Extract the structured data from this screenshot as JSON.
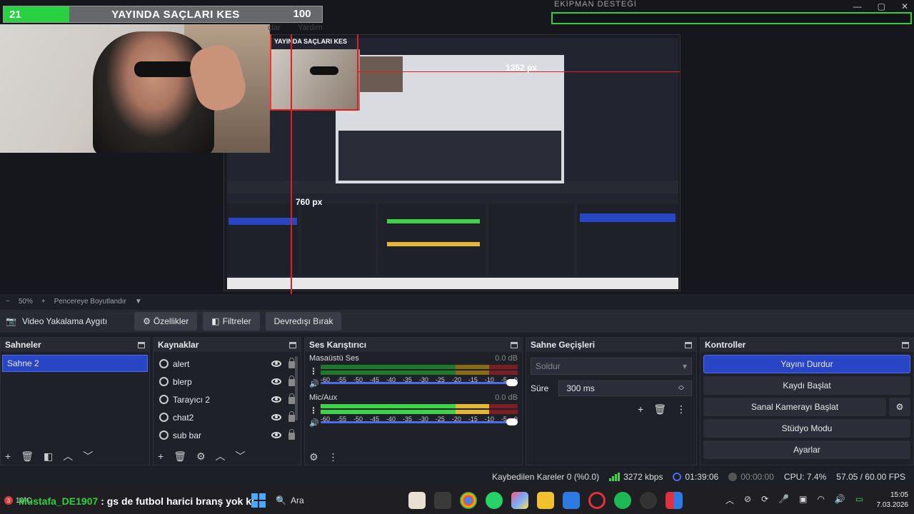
{
  "window": {
    "minimize": "—",
    "maximize": "▢",
    "close": "✕"
  },
  "overlay": {
    "count": "21",
    "title": "YAYINDA SAÇLARI KES",
    "hundred": "100",
    "left_sub": "çlar",
    "right_sub": "Yardım",
    "support_label": "EKİPMAN DESTEĞİ"
  },
  "nested": {
    "title": "YAYINDA SAÇLARI KES",
    "width_label": "1352 px",
    "height_label": "760 px"
  },
  "zoom": {
    "minus": "−",
    "value": "50%",
    "plus": "+",
    "fit": "Pencereye Boyutlandır"
  },
  "source_toolbar": {
    "source_name": "Video Yakalama Aygıtı",
    "properties": "Özellikler",
    "filters": "Filtreler",
    "deactivate": "Devredışı Bırak"
  },
  "scenes": {
    "title": "Sahneler",
    "items": [
      "Sahne 2"
    ]
  },
  "sources": {
    "title": "Kaynaklar",
    "items": [
      "alert",
      "blerp",
      "Tarayıcı 2",
      "chat2",
      "sub bar"
    ]
  },
  "mixer": {
    "title": "Ses Karıştırıcı",
    "channels": [
      {
        "name": "Masaüstü Ses",
        "db": "0.0 dB",
        "level": 0.1
      },
      {
        "name": "Mic/Aux",
        "db": "0.0 dB",
        "level": 0.9
      }
    ],
    "scale": [
      "-60",
      "-55",
      "-50",
      "-45",
      "-40",
      "-35",
      "-30",
      "-25",
      "-20",
      "-15",
      "-10",
      "-5",
      "0"
    ]
  },
  "transitions": {
    "title": "Sahne Geçişleri",
    "selected": "Soldur",
    "duration_label": "Süre",
    "duration_value": "300 ms"
  },
  "controls": {
    "title": "Kontroller",
    "stop_stream": "Yayını Durdur",
    "start_record": "Kaydı Başlat",
    "start_vcam": "Sanal Kamerayı Başlat",
    "studio_mode": "Stüdyo Modu",
    "settings": "Ayarlar"
  },
  "status": {
    "dropped": "Kaybedilen Kareler 0 (%0.0)",
    "bitrate": "3272 kbps",
    "live_time": "01:39:06",
    "rec_time": "00:00:00",
    "cpu": "CPU: 7.4%",
    "fps": "57.05 / 60.00 FPS"
  },
  "taskbar": {
    "weather": "10°C",
    "badge": "3",
    "ticker_name": "Mustafa_DE1907",
    "ticker_text": ": gs de futbol harici branş yok ki",
    "search": "Ara",
    "time": "15:05",
    "date": "7.03.2026"
  },
  "colors": {
    "accent": "#2845c6",
    "green": "#3fd14a",
    "yellow": "#e3b635",
    "red": "#d93c3c"
  }
}
